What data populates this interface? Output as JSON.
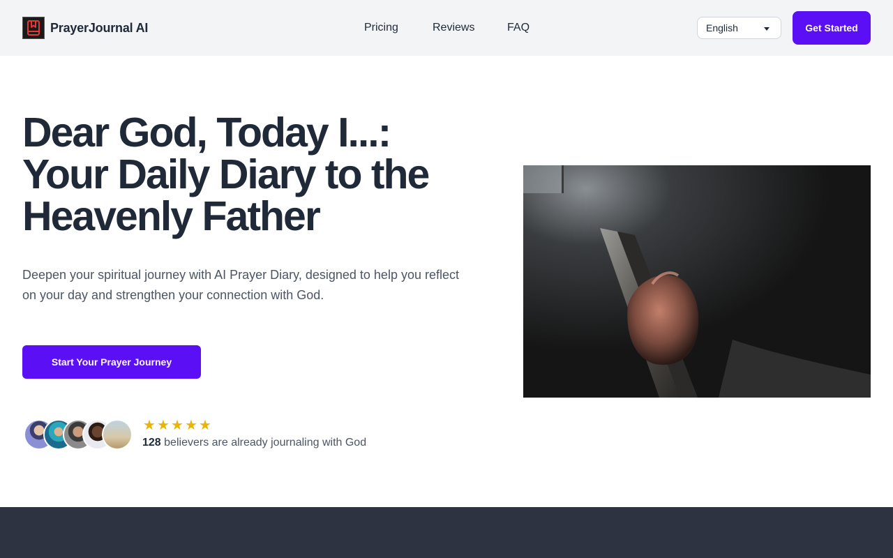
{
  "header": {
    "brand": "PrayerJournal AI",
    "logo_icon": "journal-bookmark-icon",
    "nav": [
      "Pricing",
      "Reviews",
      "FAQ"
    ],
    "language": "English",
    "cta": "Get Started"
  },
  "hero": {
    "title_line1": "Dear God, Today I...:",
    "title_line2": "Your Daily Diary to the",
    "title_line3": "Heavenly Father",
    "subtitle": "Deepen your spiritual journey with AI Prayer Diary, designed to help you reflect on your day and strengthen your connection with God.",
    "cta": "Start Your Prayer Journey",
    "rating_stars": 5,
    "believers_count": "128",
    "believers_text": "believers are already journaling with God"
  },
  "colors": {
    "accent": "#5b0ff5",
    "star": "#eab308",
    "header_bg": "#f3f4f6",
    "dark_section": "#2d3340"
  }
}
